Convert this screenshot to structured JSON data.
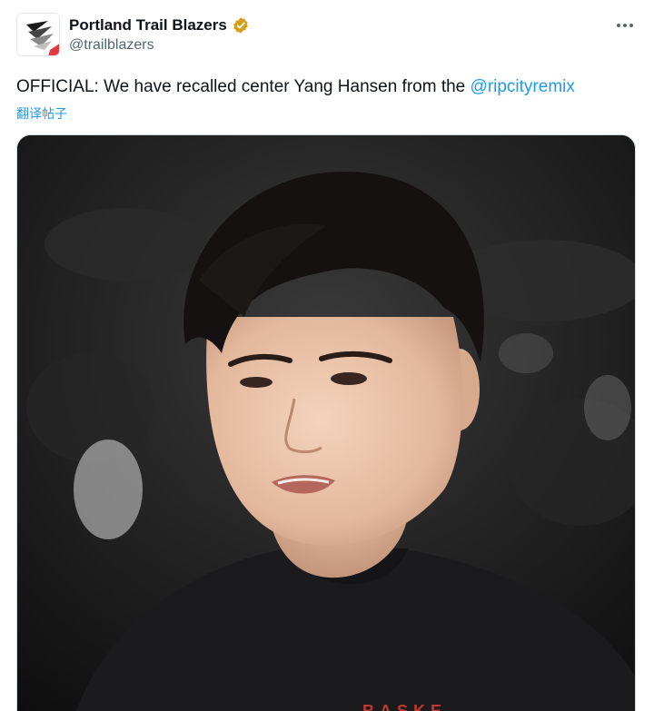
{
  "author": {
    "display_name": "Portland Trail Blazers",
    "handle": "@trailblazers",
    "avatar_icon": "trail-blazers-pinwheel-logo",
    "verified_icon": "verified-badge-icon",
    "verified_color": "#d4a017"
  },
  "post": {
    "text_prefix": "OFFICIAL: We have recalled center Yang Hansen from the ",
    "mention": "@ripcityremix",
    "translate_label": "翻译帖子",
    "accent_color": "#1d9bf0"
  },
  "menu": {
    "more_icon": "more-options-icon"
  },
  "media": {
    "jersey_text": "BASKE",
    "jersey_text_color": "#c0392b"
  }
}
